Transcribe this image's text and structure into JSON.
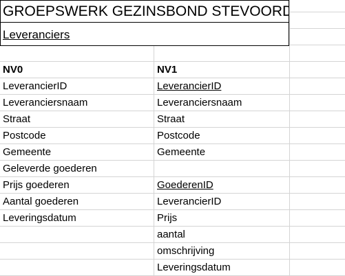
{
  "sheet": {
    "title": "GROEPSWERK GEZINSBOND STEVOORD",
    "subtitle": "Leveranciers"
  },
  "nv0": {
    "header": "NV0",
    "rows": [
      "LeverancierID",
      "Leveranciersnaam",
      "Straat",
      "Postcode",
      "Gemeente",
      "Geleverde goederen",
      "Prijs goederen",
      "Aantal goederen",
      "Leveringsdatum"
    ]
  },
  "nv1": {
    "header": "NV1",
    "rows": [
      "LeverancierID",
      "Leveranciersnaam",
      "Straat",
      "Postcode",
      "Gemeente",
      "",
      "GoederenID",
      "LeverancierID",
      "Prijs",
      "aantal",
      "omschrijving",
      "Leveringsdatum"
    ]
  }
}
